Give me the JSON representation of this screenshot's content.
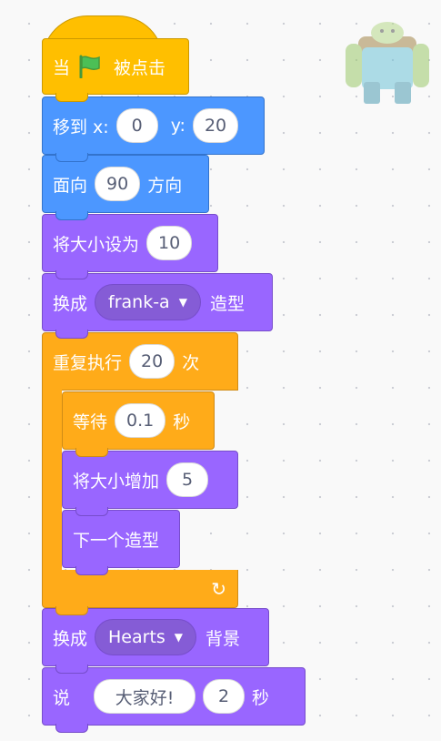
{
  "palette": {
    "motion": "#4c97ff",
    "looks": "#9966ff",
    "control": "#ffab19",
    "events": "#ffbf00",
    "canvas": "#f9f9f9"
  },
  "sprite_icon": "frank-sprite-thumbnail",
  "blocks": {
    "when_flag": {
      "pre": "当",
      "icon": "green-flag-icon",
      "post": "被点击"
    },
    "goto": {
      "label": "移到 x:",
      "x": "0",
      "ylabel": "y:",
      "y": "20"
    },
    "point": {
      "label": "面向",
      "dir": "90",
      "post": "方向"
    },
    "setsize": {
      "label": "将大小设为",
      "value": "10"
    },
    "costume": {
      "label": "换成",
      "value": "frank-a",
      "post": "造型"
    },
    "repeat": {
      "label": "重复执行",
      "times": "20",
      "post": "次"
    },
    "wait": {
      "label": "等待",
      "value": "0.1",
      "post": "秒"
    },
    "changesize": {
      "label": "将大小增加",
      "value": "5"
    },
    "nextcostume": {
      "label": "下一个造型"
    },
    "backdrop": {
      "label": "换成",
      "value": "Hearts",
      "post": "背景"
    },
    "say": {
      "label": "说",
      "message": "大家好!",
      "secs": "2",
      "post": "秒"
    }
  }
}
